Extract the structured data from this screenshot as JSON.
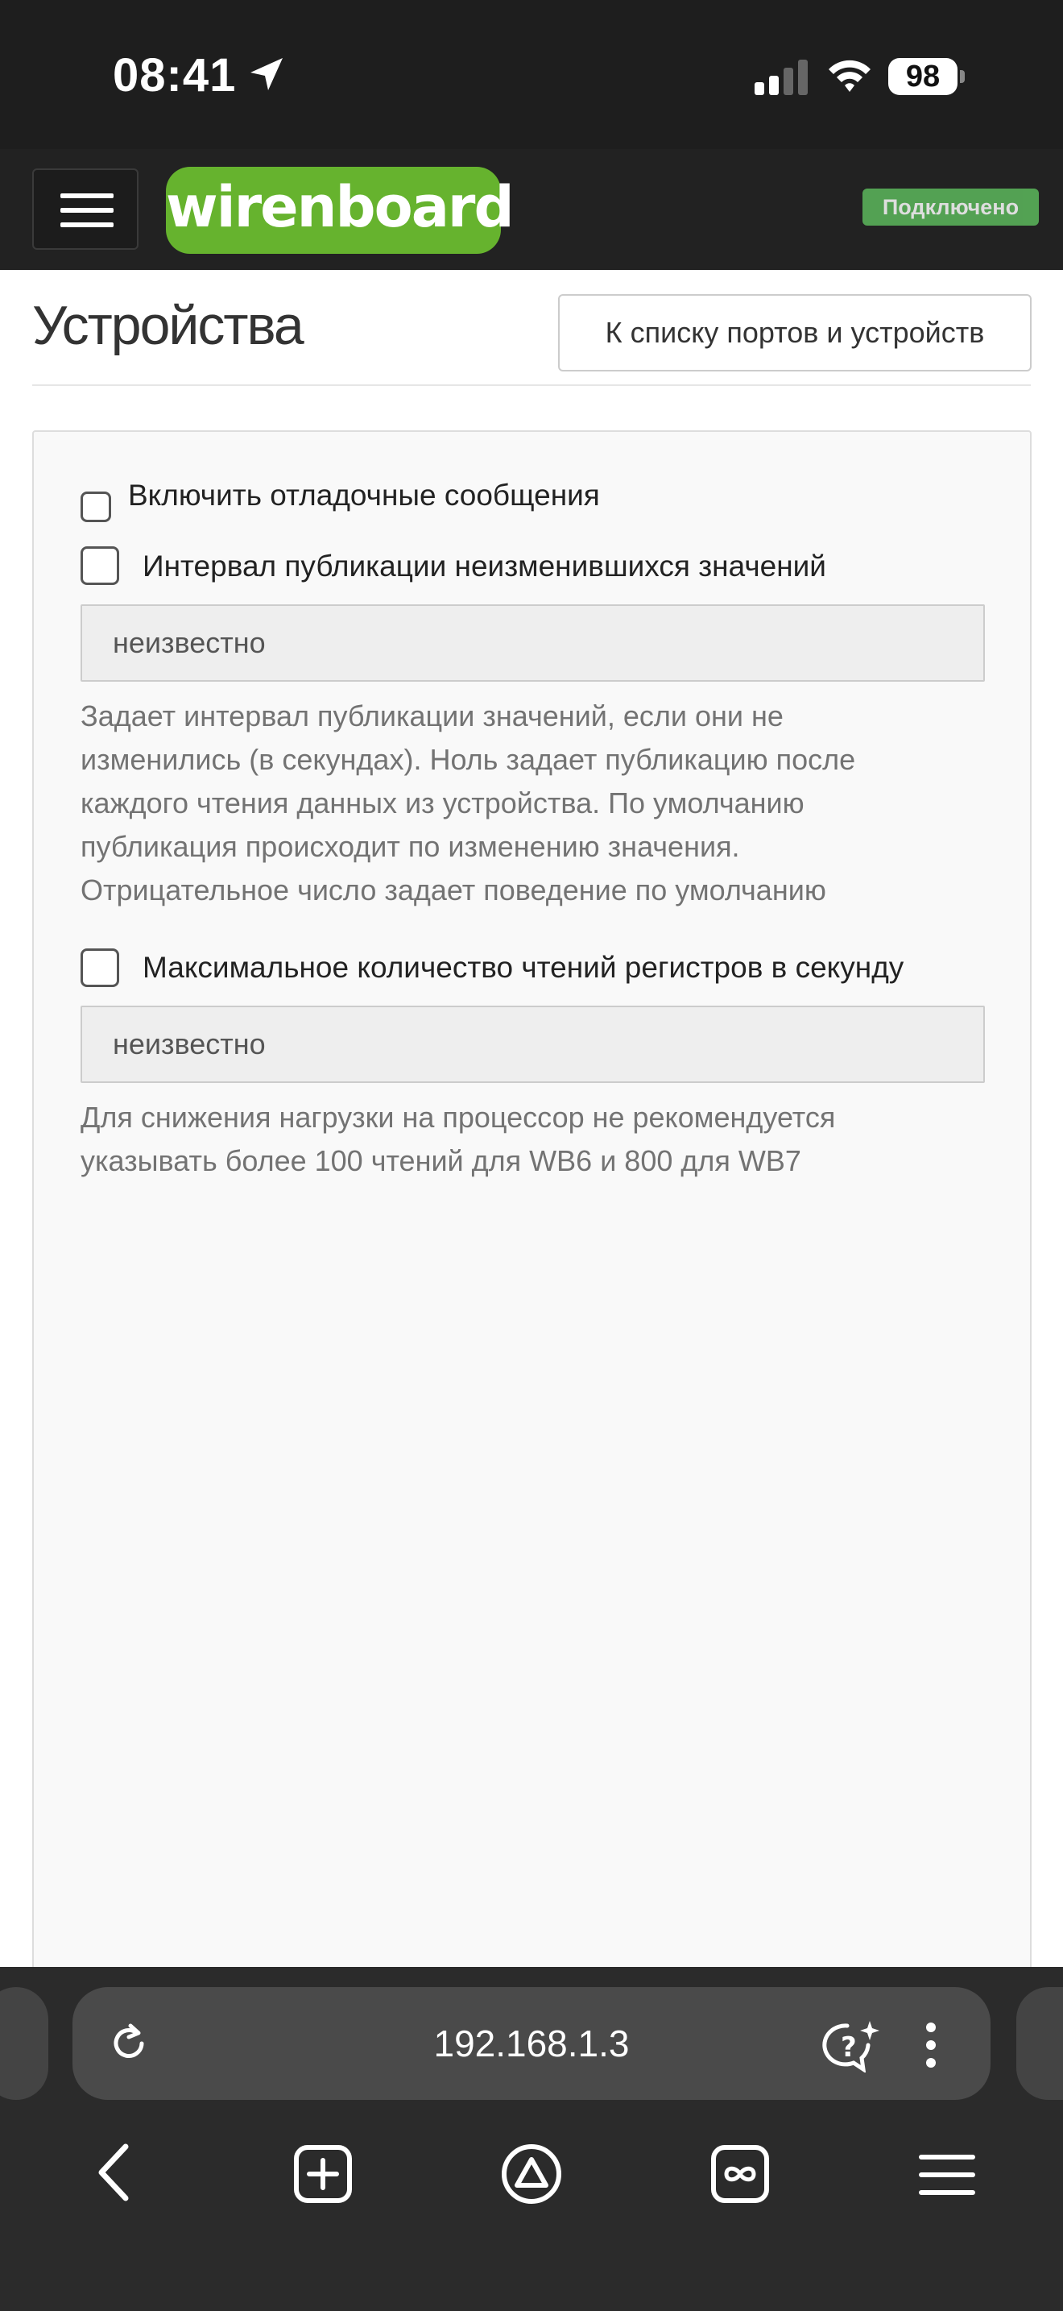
{
  "status_bar": {
    "time": "08:41",
    "battery": "98"
  },
  "navbar": {
    "logo": "wirenboard",
    "status_badge": "Подключено"
  },
  "page": {
    "title": "Устройства",
    "back_button": "К списку портов и устройств"
  },
  "settings": {
    "debug": {
      "label": "Включить отладочные сообщения",
      "checked": false
    },
    "publish_interval": {
      "label": "Интервал публикации неизменившихся значений",
      "checked": false,
      "value": "неизвестно",
      "help": [
        "Задает интервал публикации значений, если они не",
        "изменились (в секундах). Ноль задает публикацию после",
        "каждого чтения данных из устройства. По умолчанию",
        "публикация происходит по изменению значения.",
        "Отрицательное число задает поведение по умолчанию"
      ]
    },
    "max_reads": {
      "label": "Максимальное количество чтений регистров в секунду",
      "checked": false,
      "value": "неизвестно",
      "help": [
        "Для снижения нагрузки на процессор не рекомендуется",
        "указывать более 100 чтений для WB6 и 800 для WB7"
      ]
    }
  },
  "browser": {
    "url": "192.168.1.3",
    "icons": [
      "reload-icon",
      "assistant-icon",
      "more-icon",
      "back-icon",
      "new-tab-icon",
      "alice-icon",
      "tabs-icon",
      "menu-icon"
    ]
  }
}
